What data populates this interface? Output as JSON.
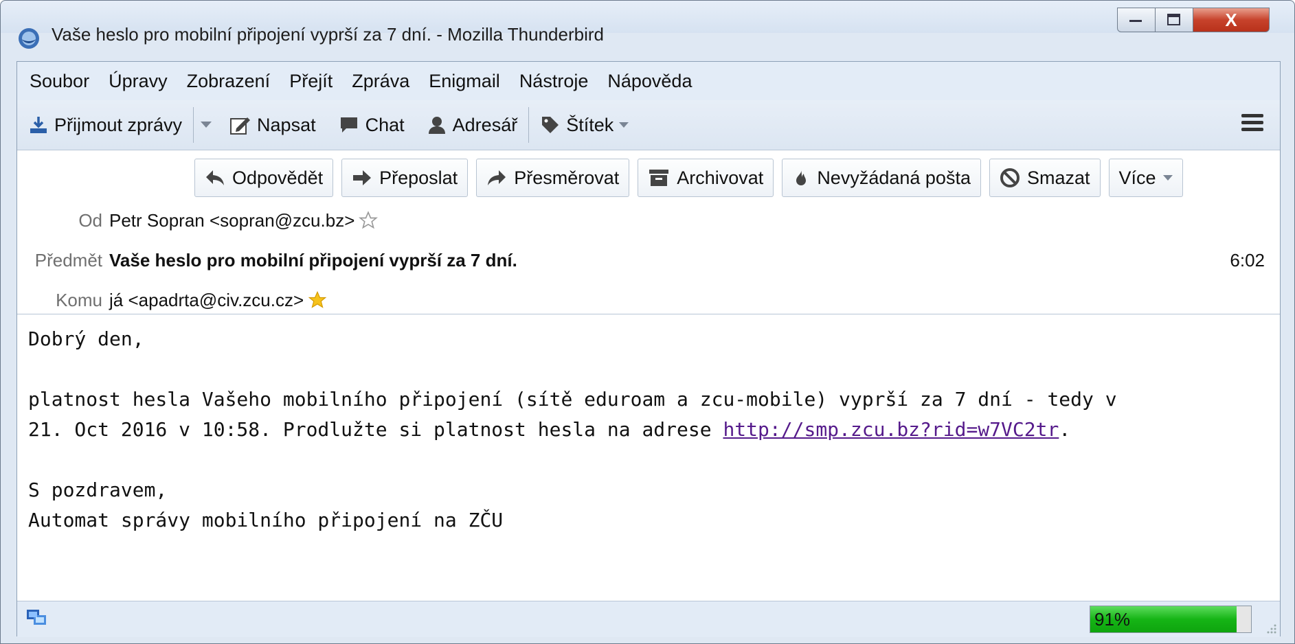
{
  "window": {
    "title": "Vaše heslo pro mobilní připojení vyprší za 7 dní. - Mozilla Thunderbird",
    "close_glyph": "X"
  },
  "menu": [
    "Soubor",
    "Úpravy",
    "Zobrazení",
    "Přejít",
    "Zpráva",
    "Enigmail",
    "Nástroje",
    "Nápověda"
  ],
  "toolbar": {
    "get_messages": "Přijmout zprávy",
    "write": "Napsat",
    "chat": "Chat",
    "address_book": "Adresář",
    "tag": "Štítek"
  },
  "actions": {
    "reply": "Odpovědět",
    "forward": "Přeposlat",
    "redirect": "Přesměrovat",
    "archive": "Archivovat",
    "junk": "Nevyžádaná pošta",
    "delete": "Smazat",
    "more": "Více"
  },
  "header": {
    "from_label": "Od",
    "from_value": "Petr Sopran <sopran@zcu.bz>",
    "subject_label": "Předmět",
    "subject_value": "Vaše heslo pro mobilní připojení vyprší za 7 dní.",
    "time": "6:02",
    "to_label": "Komu",
    "to_value": "já <apadrta@civ.zcu.cz>"
  },
  "body": {
    "greeting": "Dobrý den,",
    "line1": "platnost hesla Vašeho mobilního připojení (sítě eduroam a zcu-mobile) vyprší za 7 dní - tedy v",
    "line2_pre": "21. Oct 2016 v 10:58. Prodlužte si platnost hesla na adrese ",
    "link": "http://smp.zcu.bz?rid=w7VC2tr",
    "line2_post": ".",
    "signoff": "S pozdravem,",
    "signature": "Automat správy mobilního připojení na ZČU"
  },
  "status": {
    "progress_label": "91%",
    "progress_fraction": 0.91,
    "colors": {
      "progress": "#16b516",
      "link": "#551a8b"
    }
  }
}
